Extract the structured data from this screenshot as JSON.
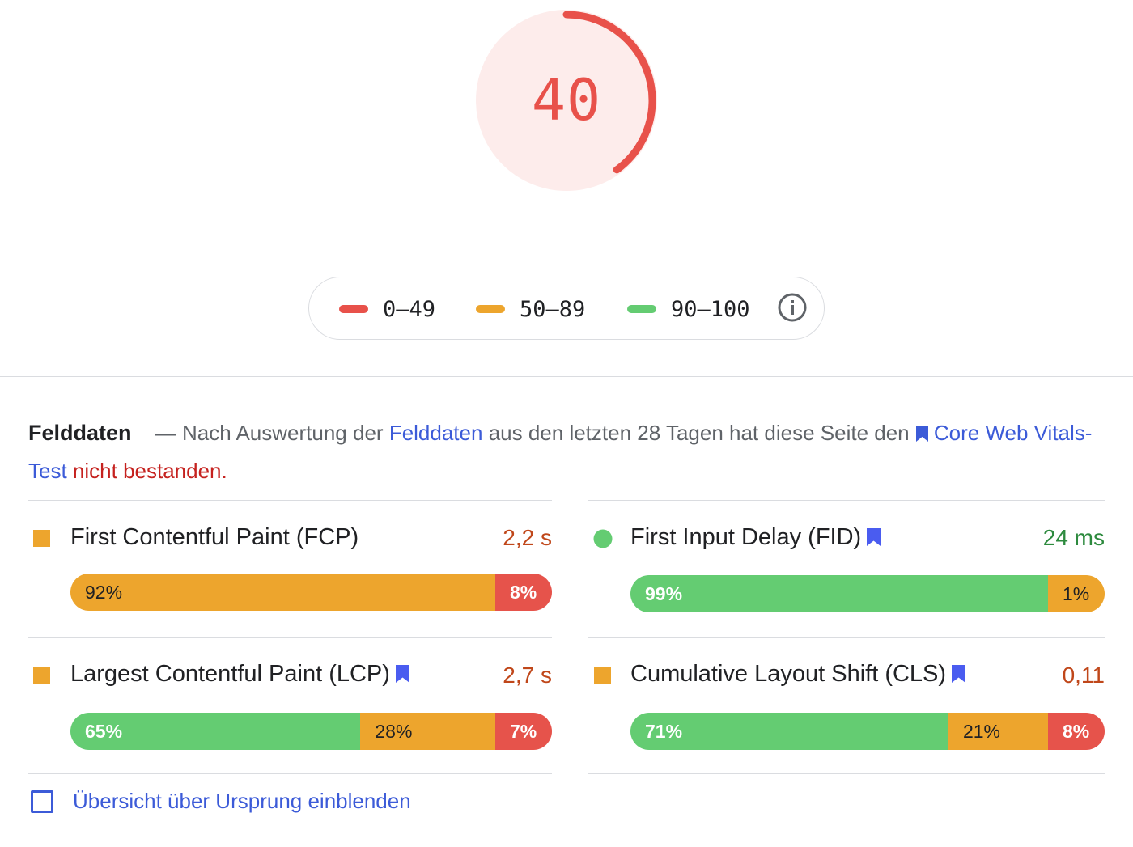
{
  "score": {
    "value": "40",
    "fraction": 0.4,
    "color": "#e8514a",
    "background_color": "#fdeceb"
  },
  "legend": {
    "items": [
      {
        "label": "0–49",
        "color": "#e8514a"
      },
      {
        "label": "50–89",
        "color": "#eda52d"
      },
      {
        "label": "90–100",
        "color": "#64cc72"
      }
    ],
    "info_icon": "info-icon"
  },
  "field_data": {
    "heading": "Felddaten",
    "dash": "—",
    "text_before_link": "Nach Auswertung der",
    "link_felddaten": "Felddaten",
    "text_after_link": "aus den letzten 28 Tagen hat diese Seite den",
    "link_core_part1": "Core",
    "link_core_part2": "Web Vitals-Test",
    "fail_text": "nicht bestanden",
    "period": "."
  },
  "metrics": [
    {
      "title": "First Contentful Paint (FCP)",
      "value": "2,2 s",
      "value_color": "#c0471a",
      "indicator": "orange-square",
      "bookmark": false,
      "distribution": [
        {
          "label": "92%",
          "fraction": 0.92,
          "rating": "avg"
        },
        {
          "label": "8%",
          "fraction": 0.08,
          "rating": "poor"
        }
      ]
    },
    {
      "title": "First Input Delay (FID)",
      "value": "24 ms",
      "value_color": "#2d8a3e",
      "indicator": "green-circle",
      "bookmark": true,
      "distribution": [
        {
          "label": "99%",
          "fraction": 0.99,
          "rating": "good"
        },
        {
          "label": "1%",
          "fraction": 0.01,
          "rating": "avg"
        }
      ]
    },
    {
      "title": "Largest Contentful Paint (LCP)",
      "value": "2,7 s",
      "value_color": "#c0471a",
      "indicator": "orange-square",
      "bookmark": true,
      "distribution": [
        {
          "label": "65%",
          "fraction": 0.65,
          "rating": "good"
        },
        {
          "label": "28%",
          "fraction": 0.28,
          "rating": "avg"
        },
        {
          "label": "7%",
          "fraction": 0.07,
          "rating": "poor"
        }
      ]
    },
    {
      "title": "Cumulative Layout Shift (CLS)",
      "value": "0,11",
      "value_color": "#c0471a",
      "indicator": "orange-square",
      "bookmark": true,
      "distribution": [
        {
          "label": "71%",
          "fraction": 0.71,
          "rating": "good"
        },
        {
          "label": "21%",
          "fraction": 0.21,
          "rating": "avg"
        },
        {
          "label": "8%",
          "fraction": 0.08,
          "rating": "poor"
        }
      ]
    }
  ],
  "origin_toggle": {
    "label": "Übersicht über Ursprung einblenden",
    "checked": false
  },
  "colors": {
    "link": "#3c5bd8",
    "fail": "#c5221f",
    "good": "#64cc72",
    "average": "#eda52d",
    "poor": "#e6534b"
  }
}
